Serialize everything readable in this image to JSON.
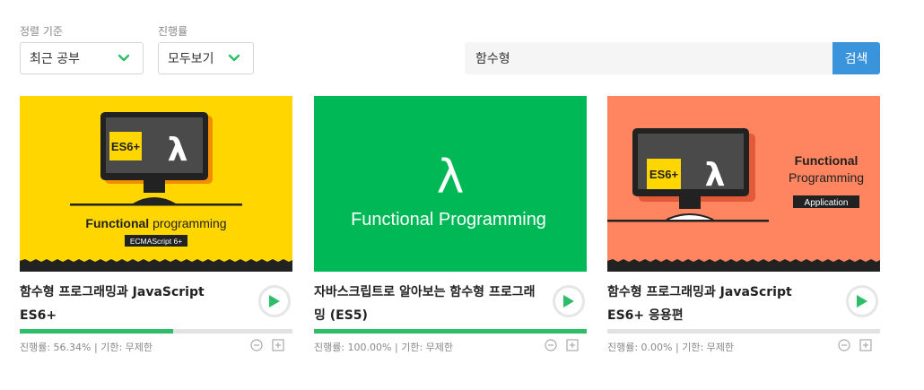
{
  "filters": {
    "sort_label": "정렬 기준",
    "sort_value": "최근 공부",
    "progress_label": "진행률",
    "progress_value": "모두보기"
  },
  "search": {
    "value": "함수형",
    "button_label": "검색"
  },
  "colors": {
    "accent_green": "#2ebd68",
    "search_blue": "#3a94db",
    "thumb_yellow": "#ffd600",
    "thumb_green": "#00b856",
    "thumb_orange": "#ff8460"
  },
  "courses": [
    {
      "title": "함수형 프로그래밍과 JavaScript ES6+",
      "progress_percent": 56.34,
      "meta": "진행률: 56.34% | 기한: 무제한",
      "thumb": {
        "badge": "ES6+",
        "lambda": "λ",
        "headline_bold": "Functional",
        "headline_rest": " programming",
        "tag": "ECMAScript 6+"
      }
    },
    {
      "title": "자바스크립트로 알아보는 함수형 프로그래밍 (ES5)",
      "progress_percent": 100,
      "meta": "진행률: 100.00% | 기한: 무제한",
      "thumb": {
        "lambda": "λ",
        "headline": "Functional Programming"
      }
    },
    {
      "title": "함수형 프로그래밍과 JavaScript ES6+ 응용편",
      "progress_percent": 0,
      "meta": "진행률: 0.00% | 기한: 무제한",
      "thumb": {
        "badge": "ES6+",
        "lambda": "λ",
        "line1": "Functional",
        "line2": "Programming",
        "tag": "Application"
      }
    }
  ]
}
